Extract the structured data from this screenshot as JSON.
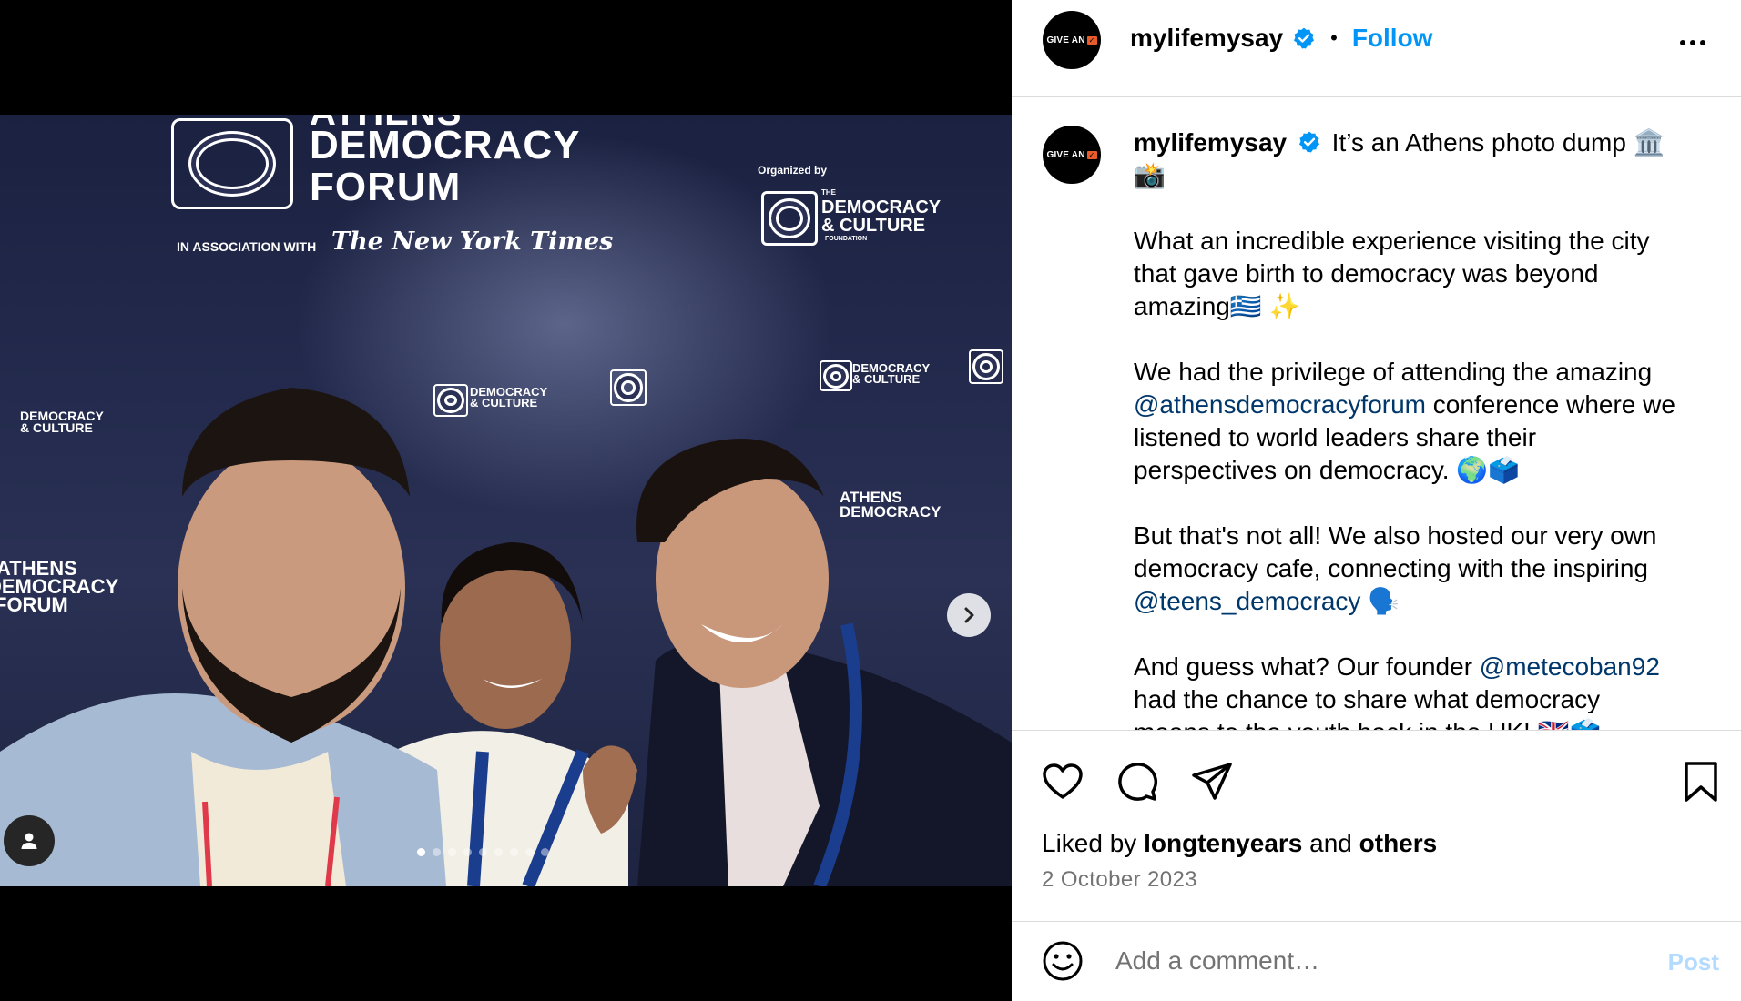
{
  "post": {
    "username": "mylifemysay",
    "avatar_text": "GIVE AN",
    "follow_label": "Follow",
    "separator": "•",
    "caption": {
      "first_line": "It’s an Athens photo dump 🏛️",
      "first_line_emoji": "📸",
      "p1": "What an incredible experience visiting the city that gave birth to democracy was beyond amazing🇬🇷 ✨",
      "p2_a": "We had the privilege of attending the amazing ",
      "p2_mention": "@athensdemocracyforum",
      "p2_b": " conference where we listened to world leaders share their perspectives on democracy. 🌍🗳️",
      "p3_a": "But that's not all! We also hosted our very own democracy cafe, connecting with the inspiring ",
      "p3_mention": "@teens_democracy",
      "p3_b": " 🗣️",
      "p4_a": "And guess what? Our founder ",
      "p4_mention": "@metecoban92",
      "p4_b": " had the chance to share what democracy means to the youth back in the UK! 🇬🇧🗳️"
    },
    "likes": {
      "prefix": "Liked by ",
      "user": "longtenyears",
      "middle": " and ",
      "others": "others"
    },
    "date": "2 October 2023",
    "comment_placeholder": "Add a comment…",
    "post_label": "Post"
  },
  "photo": {
    "forum_line1": "ATHENS",
    "forum_line2": "DEMOCRACY",
    "forum_line3": "FORUM",
    "association": "IN ASSOCIATION WITH",
    "nyt": "The New York Times",
    "organized_by": "Organized by",
    "org_the": "THE",
    "org_line1": "DEMOCRACY",
    "org_line2": "& CULTURE",
    "org_line3": "FOUNDATION",
    "lanyard_text": "ATHENS DEMOCRACY FORUM",
    "slide_count": 9,
    "active_slide": 1
  },
  "icons": [
    "verified-badge-icon",
    "more-options-icon",
    "heart-icon",
    "comment-icon",
    "share-icon",
    "bookmark-icon",
    "emoji-icon",
    "chevron-right-icon",
    "user-tag-icon"
  ],
  "colors": {
    "accent": "#0095f6",
    "mention": "#00376b",
    "border": "#dbdbdb",
    "muted": "#737373",
    "post_disabled": "#b3dbff"
  }
}
